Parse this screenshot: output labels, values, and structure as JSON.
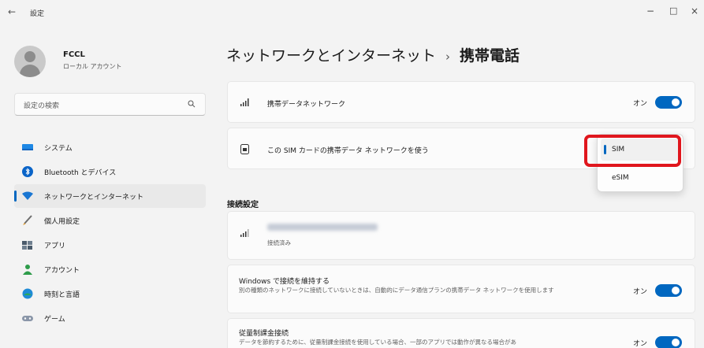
{
  "window": {
    "back_glyph": "←",
    "title": "設定",
    "controls": {
      "minimize": "−",
      "maximize": "□",
      "close": "×"
    }
  },
  "profile": {
    "name": "FCCL",
    "account_type": "ローカル アカウント"
  },
  "search": {
    "placeholder": "設定の検索"
  },
  "sidebar": {
    "items": [
      {
        "label": "システム",
        "icon": "monitor-icon",
        "active": false
      },
      {
        "label": "Bluetooth とデバイス",
        "icon": "bluetooth-icon",
        "active": false
      },
      {
        "label": "ネットワークとインターネット",
        "icon": "wifi-icon",
        "active": true
      },
      {
        "label": "個人用設定",
        "icon": "brush-icon",
        "active": false
      },
      {
        "label": "アプリ",
        "icon": "apps-icon",
        "active": false
      },
      {
        "label": "アカウント",
        "icon": "person-icon",
        "active": false
      },
      {
        "label": "時刻と言語",
        "icon": "globe-clock-icon",
        "active": false
      },
      {
        "label": "ゲーム",
        "icon": "gamepad-icon",
        "active": false
      }
    ]
  },
  "breadcrumb": {
    "parent": "ネットワークとインターネット",
    "separator": "›",
    "current": "携帯電話"
  },
  "cards": {
    "cellular": {
      "title": "携帯データネットワーク",
      "toggle_label": "オン",
      "toggle_on": true
    },
    "sim": {
      "title": "この SIM カードの携帯データ ネットワークを使う"
    },
    "connection": {
      "status": "接続済み"
    },
    "keep_connected": {
      "title": "Windows で接続を維持する",
      "desc": "別の種類のネットワークに接続していないときは、自動的にデータ通信プランの携帯データ ネットワークを使用します",
      "toggle_label": "オン",
      "toggle_on": true
    },
    "metered": {
      "title": "従量制課金接続",
      "desc": "データを節約するために、従量制課金接続を使用している場合、一部のアプリでは動作が異なる場合があ",
      "toggle_label": "オン",
      "toggle_on": true
    }
  },
  "section": {
    "connection_settings": "接続設定"
  },
  "dropdown": {
    "options": [
      {
        "label": "SIM",
        "selected": true
      },
      {
        "label": "eSIM",
        "selected": false
      }
    ]
  },
  "colors": {
    "accent": "#0067c0",
    "highlight": "#e0161d"
  }
}
